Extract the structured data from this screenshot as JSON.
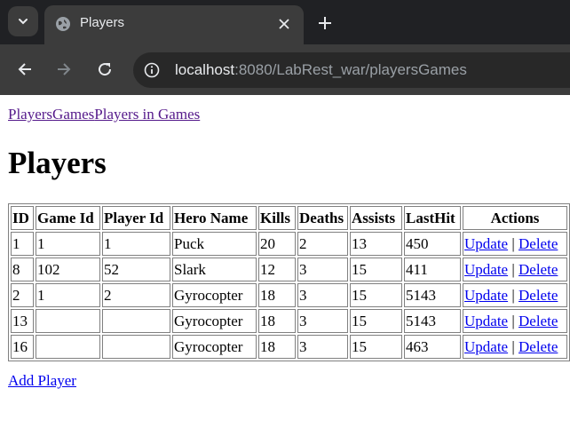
{
  "browser": {
    "tab_title": "Players",
    "url_host": "localhost",
    "url_rest": ":8080/LabRest_war/playersGames"
  },
  "nav": {
    "players": "Players",
    "games": "Games",
    "players_in_games": "Players in Games"
  },
  "heading": "Players",
  "table": {
    "headers": [
      "ID",
      "Game Id",
      "Player Id",
      "Hero Name",
      "Kills",
      "Deaths",
      "Assists",
      "LastHit",
      "Actions"
    ],
    "rows": [
      {
        "id": "1",
        "game_id": "1",
        "player_id": "1",
        "hero": "Puck",
        "kills": "20",
        "deaths": "2",
        "assists": "13",
        "lasthit": "450"
      },
      {
        "id": "8",
        "game_id": "102",
        "player_id": "52",
        "hero": "Slark",
        "kills": "12",
        "deaths": "3",
        "assists": "15",
        "lasthit": "411"
      },
      {
        "id": "2",
        "game_id": "1",
        "player_id": "2",
        "hero": "Gyrocopter",
        "kills": "18",
        "deaths": "3",
        "assists": "15",
        "lasthit": "5143"
      },
      {
        "id": "13",
        "game_id": "",
        "player_id": "",
        "hero": "Gyrocopter",
        "kills": "18",
        "deaths": "3",
        "assists": "15",
        "lasthit": "5143"
      },
      {
        "id": "16",
        "game_id": "",
        "player_id": "",
        "hero": "Gyrocopter",
        "kills": "18",
        "deaths": "3",
        "assists": "15",
        "lasthit": "463"
      }
    ],
    "update_label": "Update",
    "separator": "|",
    "delete_label": "Delete"
  },
  "add_player_label": "Add Player"
}
